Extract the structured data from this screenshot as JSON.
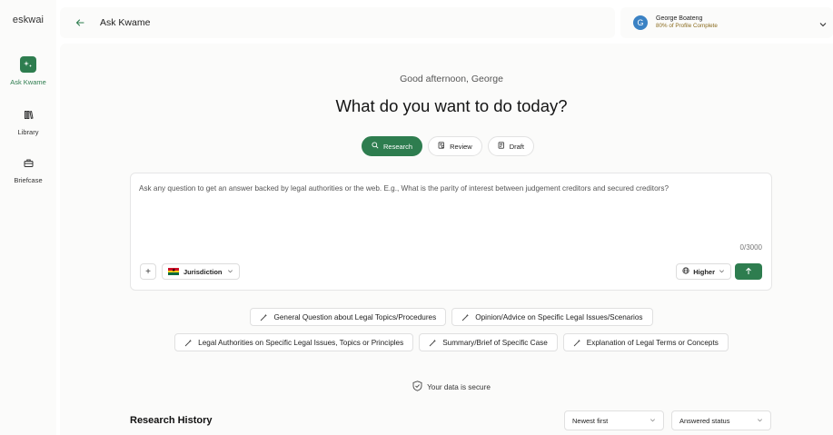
{
  "brand": "eskwai",
  "rail": {
    "items": [
      {
        "label": "Ask Kwame",
        "icon": "sparkle-icon"
      },
      {
        "label": "Library",
        "icon": "books-icon"
      },
      {
        "label": "Briefcase",
        "icon": "briefcase-icon"
      }
    ]
  },
  "header": {
    "title": "Ask Kwame"
  },
  "profile": {
    "initial": "G",
    "name": "George Boateng",
    "status": "80% of Profile Complete"
  },
  "main": {
    "greeting": "Good afternoon, George",
    "headline": "What do you want to do today?",
    "modes": [
      {
        "label": "Research",
        "icon": "search-icon"
      },
      {
        "label": "Review",
        "icon": "review-icon"
      },
      {
        "label": "Draft",
        "icon": "draft-icon"
      }
    ],
    "ask": {
      "placeholder": "Ask any question to get an answer backed by legal authorities or the web. E.g., What is the parity of interest between judgement creditors and secured creditors?",
      "counter": "0/3000",
      "plus": "+",
      "jurisdiction": "Jurisdiction",
      "tier": "Higher"
    },
    "suggestions_row1": [
      "General Question about Legal Topics/Procedures",
      "Opinion/Advice on Specific Legal Issues/Scenarios"
    ],
    "suggestions_row2": [
      "Legal Authorities on Specific Legal Issues, Topics or Principles",
      "Summary/Brief of Specific Case",
      "Explanation of Legal Terms or Concepts"
    ],
    "secure_note": "Your data is secure"
  },
  "history": {
    "title": "Research History",
    "sort": "Newest first",
    "filter": "Answered status"
  },
  "colors": {
    "accent": "#2e7d4f",
    "avatar": "#3b82c4",
    "panel": "#fbfbfa"
  }
}
